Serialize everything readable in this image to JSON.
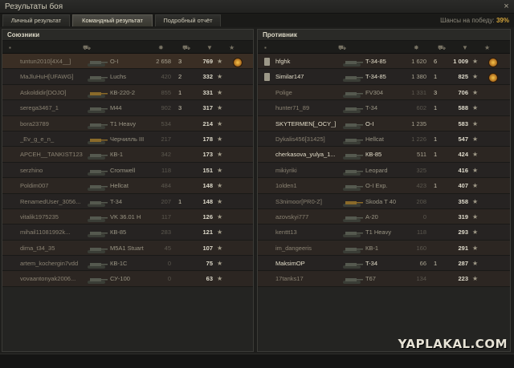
{
  "window": {
    "title": "Результаты боя",
    "close_glyph": "×"
  },
  "tabs": [
    {
      "label": "Личный результат",
      "active": false
    },
    {
      "label": "Командный результат",
      "active": true
    },
    {
      "label": "Подробный отчёт",
      "active": false
    }
  ],
  "win_chance": {
    "label": "Шансы на победу: ",
    "value": "39%"
  },
  "allies": {
    "title": "Союзники",
    "rows": [
      {
        "player": "tuntun2010[4X4__]",
        "vehicle": "О-I",
        "damage": "2 658",
        "kills": "3",
        "xp": "769",
        "badge": true,
        "player_bright": false
      },
      {
        "player": "MaJluHuH[UFAWG]",
        "vehicle": "Luchs",
        "damage": "420",
        "kills": "2",
        "xp": "332"
      },
      {
        "player": "Askoldidir[DOJO]",
        "vehicle": "КВ-220-2",
        "damage": "855",
        "kills": "1",
        "xp": "331"
      },
      {
        "player": "serega3467_1",
        "vehicle": "M44",
        "damage": "902",
        "kills": "3",
        "xp": "317"
      },
      {
        "player": "bora23789",
        "vehicle": "T1 Heavy",
        "damage": "534",
        "kills": "",
        "xp": "214"
      },
      {
        "player": "_Ev_g_e_n_",
        "vehicle": "Черчилль III",
        "damage": "217",
        "kills": "",
        "xp": "178"
      },
      {
        "player": "APCEH__TANKIST123",
        "vehicle": "КВ-1",
        "damage": "342",
        "kills": "",
        "xp": "173"
      },
      {
        "player": "serzhino",
        "vehicle": "Cromwell",
        "damage": "118",
        "kills": "",
        "xp": "151"
      },
      {
        "player": "Poldim007",
        "vehicle": "Hellcat",
        "damage": "484",
        "kills": "",
        "xp": "148"
      },
      {
        "player": "RenamedUser_3056...",
        "vehicle": "T-34",
        "damage": "207",
        "kills": "1",
        "xp": "148"
      },
      {
        "player": "vitalik1975235",
        "vehicle": "VK 36.01 H",
        "damage": "117",
        "kills": "",
        "xp": "126"
      },
      {
        "player": "mihail11081992k...",
        "vehicle": "КВ-85",
        "damage": "283",
        "kills": "",
        "xp": "121"
      },
      {
        "player": "dima_t34_35",
        "vehicle": "M5A1 Stuart",
        "damage": "45",
        "kills": "",
        "xp": "107"
      },
      {
        "player": "artem_kochergin7vdd",
        "vehicle": "КВ-1С",
        "damage": "0",
        "kills": "",
        "xp": "75"
      },
      {
        "player": "vovaantonyak2006...",
        "vehicle": "СУ-100",
        "damage": "0",
        "kills": "",
        "xp": "63"
      }
    ]
  },
  "enemies": {
    "title": "Противник",
    "rows": [
      {
        "player": "hfghk",
        "vehicle": "T-34-85",
        "damage": "1 620",
        "kills": "6",
        "xp": "1 009",
        "badge": true,
        "bright": true,
        "sq": true
      },
      {
        "player": "Similar147",
        "vehicle": "T-34-85",
        "damage": "1 380",
        "kills": "1",
        "xp": "825",
        "badge": true,
        "bright": true,
        "sq": true
      },
      {
        "player": "Polige",
        "vehicle": "FV304",
        "damage": "1 331",
        "kills": "3",
        "xp": "706"
      },
      {
        "player": "hunter71_89",
        "vehicle": "T-34",
        "damage": "602",
        "kills": "1",
        "xp": "588"
      },
      {
        "player": "SKYTERMEN[_OCY_]",
        "vehicle": "О-I",
        "damage": "1 235",
        "kills": "",
        "xp": "583",
        "bright": true
      },
      {
        "player": "Dykalis456[31425]",
        "vehicle": "Hellcat",
        "damage": "1 226",
        "kills": "1",
        "xp": "547"
      },
      {
        "player": "cherkasova_yulya_1...",
        "vehicle": "КВ-85",
        "damage": "511",
        "kills": "1",
        "xp": "424",
        "bright": true
      },
      {
        "player": "mikiyriki",
        "vehicle": "Leopard",
        "damage": "325",
        "kills": "",
        "xp": "416"
      },
      {
        "player": "1olden1",
        "vehicle": "О-I Exp.",
        "damage": "423",
        "kills": "1",
        "xp": "407"
      },
      {
        "player": "S3nimoor[PR0-Z]",
        "vehicle": "Skoda T 40",
        "damage": "208",
        "kills": "",
        "xp": "358"
      },
      {
        "player": "azovskyi777",
        "vehicle": "А-20",
        "damage": "0",
        "kills": "",
        "xp": "319"
      },
      {
        "player": "kenttt13",
        "vehicle": "T1 Heavy",
        "damage": "118",
        "kills": "",
        "xp": "293"
      },
      {
        "player": "im_dangeeris",
        "vehicle": "КВ-1",
        "damage": "160",
        "kills": "",
        "xp": "291"
      },
      {
        "player": "MaksimOP",
        "vehicle": "T-34",
        "damage": "66",
        "kills": "1",
        "xp": "287",
        "bright": true
      },
      {
        "player": "17tanks17",
        "vehicle": "T67",
        "damage": "134",
        "kills": "",
        "xp": "223"
      }
    ]
  },
  "watermark": "YAPLAKAL.COM"
}
